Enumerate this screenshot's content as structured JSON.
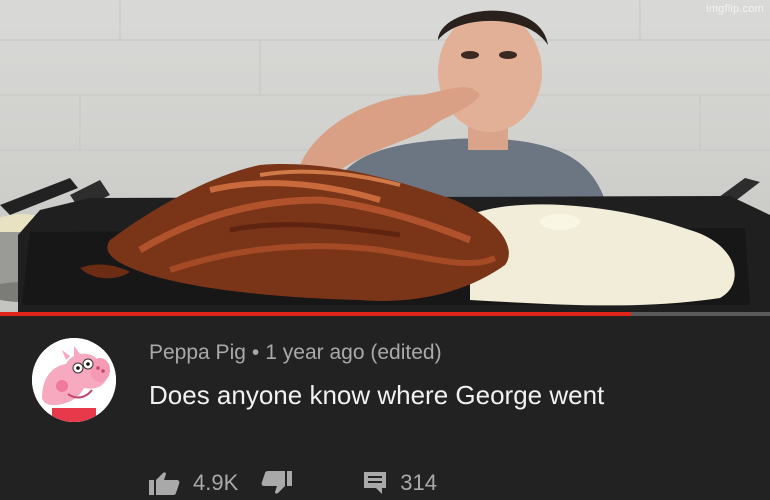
{
  "watermark": "imgflip.com",
  "video": {
    "progress_fraction": 0.82,
    "scene": "person tasting from fingers beside a griddle piled with bacon and a pool of gravy",
    "colors": {
      "wall": "#d4d4d2",
      "griddle": "#1e1e1e",
      "bacon": "#8c3f1e",
      "gravy": "#f1ecd5",
      "shirt": "#687380",
      "progress": "#e1251b"
    }
  },
  "comment": {
    "author": "Peppa Pig",
    "separator": "•",
    "timestamp": "1 year ago (edited)",
    "text": "Does anyone know where George went",
    "like_count": "4.9K",
    "reply_count": "314",
    "icons": [
      "thumbs-up-icon",
      "thumbs-down-icon",
      "reply-icon"
    ]
  },
  "theme": {
    "background": "#222222",
    "meta_text": "#a9a9a9",
    "body_text": "#f1f1f1"
  }
}
